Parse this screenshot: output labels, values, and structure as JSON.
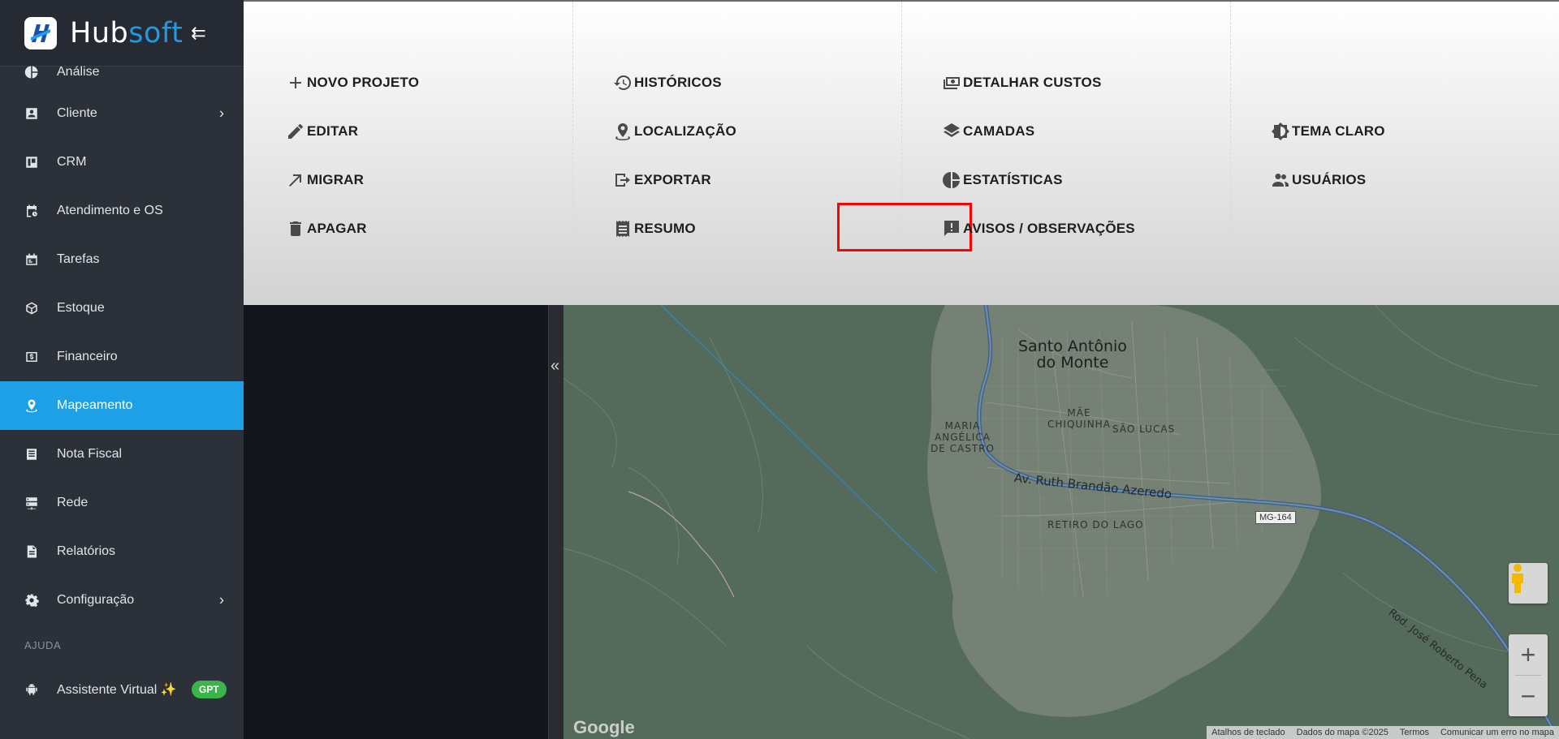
{
  "brand": {
    "name_part1": "Hub",
    "name_part2": "soft",
    "collapse_glyph": "⇇"
  },
  "sidebar": {
    "items": [
      {
        "label": "Análise",
        "icon": "pie-chart-icon"
      },
      {
        "label": "Cliente",
        "icon": "contact-card-icon",
        "has_submenu": true
      },
      {
        "label": "CRM",
        "icon": "kanban-board-icon"
      },
      {
        "label": "Atendimento e OS",
        "icon": "calendar-clock-icon"
      },
      {
        "label": "Tarefas",
        "icon": "task-calendar-icon"
      },
      {
        "label": "Estoque",
        "icon": "box-icon"
      },
      {
        "label": "Financeiro",
        "icon": "money-icon"
      },
      {
        "label": "Mapeamento",
        "icon": "map-pin-icon",
        "active": true
      },
      {
        "label": "Nota Fiscal",
        "icon": "document-icon"
      },
      {
        "label": "Rede",
        "icon": "server-icon"
      },
      {
        "label": "Relatórios",
        "icon": "report-icon"
      },
      {
        "label": "Configuração",
        "icon": "gear-icon",
        "has_submenu": true
      }
    ],
    "section_help": "AJUDA",
    "assistant": {
      "label": "Assistente Virtual ✨",
      "badge": "GPT",
      "icon": "android-icon"
    },
    "chevron": "›",
    "active_color": "#1da0e6"
  },
  "menu": {
    "col1": [
      {
        "label": "NOVO PROJETO",
        "icon": "plus-icon"
      },
      {
        "label": "EDITAR",
        "icon": "pencil-icon"
      },
      {
        "label": "MIGRAR",
        "icon": "arrow-up-right-icon"
      },
      {
        "label": "APAGAR",
        "icon": "trash-icon"
      }
    ],
    "col2": [
      {
        "label": "HISTÓRICOS",
        "icon": "history-icon"
      },
      {
        "label": "LOCALIZAÇÃO",
        "icon": "location-pin-icon"
      },
      {
        "label": "EXPORTAR",
        "icon": "export-icon"
      },
      {
        "label": "RESUMO",
        "icon": "receipt-icon",
        "highlighted": true
      }
    ],
    "col3": [
      {
        "label": "DETALHAR CUSTOS",
        "icon": "cash-icon"
      },
      {
        "label": "CAMADAS",
        "icon": "layers-icon"
      },
      {
        "label": "ESTATÍSTICAS",
        "icon": "pie-chart-icon"
      },
      {
        "label": "AVISOS / OBSERVAÇÕES",
        "icon": "feedback-icon"
      }
    ],
    "col4": [
      {
        "label": "TEMA CLARO",
        "icon": "brightness-icon"
      },
      {
        "label": "USUÁRIOS",
        "icon": "users-icon"
      }
    ],
    "highlight_color": "#ff0000"
  },
  "splitter": {
    "glyph": "«"
  },
  "map": {
    "city": "Santo Antônio\ndo Monte",
    "neighborhoods": [
      "MARIA\nANGÉLICA\nDE CASTRO",
      "MÃE\nCHIQUINHA",
      "SÃO LUCAS",
      "RETIRO DO LAGO"
    ],
    "road_main": "Av. Ruth Brandão Azeredo",
    "road_highway": "Rod. José Roberto Pena",
    "shield": "MG-164",
    "zoom_in": "+",
    "zoom_out": "−",
    "logo": "Google",
    "attribution": [
      "Atalhos de teclado",
      "Dados do mapa ©2025",
      "Termos",
      "Comunicar um erro no mapa"
    ]
  }
}
